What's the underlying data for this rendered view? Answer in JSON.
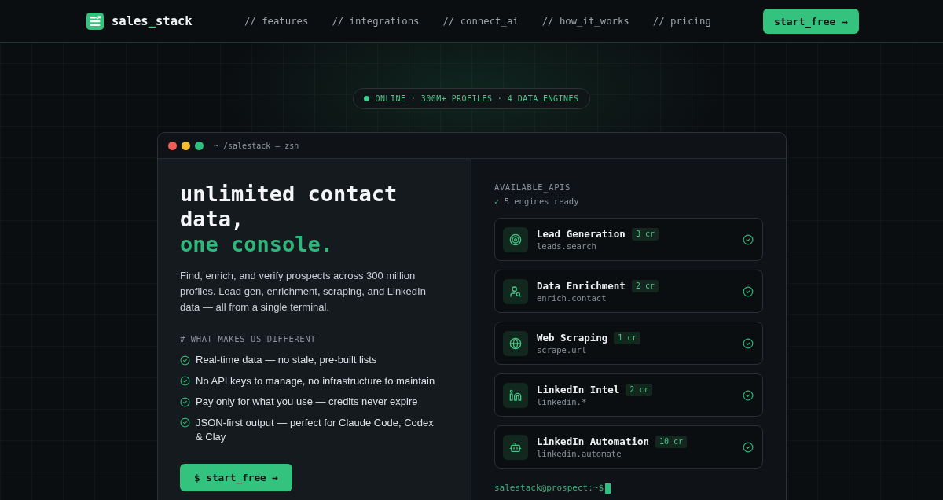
{
  "nav": {
    "logo": {
      "parts": [
        {
          "text": "sales",
          "accent": false
        },
        {
          "text": "_",
          "accent": true
        },
        {
          "text": "stack",
          "accent": false
        }
      ]
    },
    "links": [
      "// features",
      "// integrations",
      "// connect_ai",
      "// how_it_works",
      "// pricing"
    ],
    "cta": "start_free →"
  },
  "status_pill": {
    "online": true,
    "text": "ONLINE · 300M+ PROFILES · 4 DATA ENGINES"
  },
  "terminal": {
    "window_buttons": [
      {
        "color": "#ef5f57"
      },
      {
        "color": "#f4bd2f"
      },
      {
        "color": "#2fbf7f"
      }
    ],
    "title": "~ /salestack — zsh",
    "hero": {
      "headline": [
        {
          "text": "unlimited contact data,",
          "accent": false
        },
        {
          "text": "one console.",
          "accent": true
        }
      ],
      "description": "Find, enrich, and verify prospects across 300 million profiles. Lead gen, enrichment, scraping, and LinkedIn data — all from a single terminal.",
      "features_heading": "# WHAT MAKES US DIFFERENT",
      "features": [
        "Real-time data — no stale, pre-built lists",
        "No API keys to manage, no infrastructure to maintain",
        "Pay only for what you use — credits never expire",
        "JSON-first output — perfect for Claude Code, Codex & Clay"
      ],
      "button": "$ start_free →"
    },
    "apis": {
      "heading": "AVAILABLE_APIS",
      "status": {
        "mark": "✓",
        "text": "5 engines ready"
      },
      "items": [
        {
          "kind": "target",
          "name": "Lead Generation",
          "cost": "3 cr",
          "endpoint": "leads.search",
          "ready": true
        },
        {
          "kind": "person_search",
          "name": "Data Enrichment",
          "cost": "2 cr",
          "endpoint": "enrich.contact",
          "ready": true
        },
        {
          "kind": "globe",
          "name": "Web Scraping",
          "cost": "1 cr",
          "endpoint": "scrape.url",
          "ready": true
        },
        {
          "kind": "linkedin",
          "name": "LinkedIn Intel",
          "cost": "2 cr",
          "endpoint": "linkedin.*",
          "ready": true
        },
        {
          "kind": "robot",
          "name": "LinkedIn Automation",
          "cost": "10 cr",
          "endpoint": "linkedin.automate",
          "ready": true
        }
      ],
      "prompt": "salestack@prospect:~$"
    }
  }
}
